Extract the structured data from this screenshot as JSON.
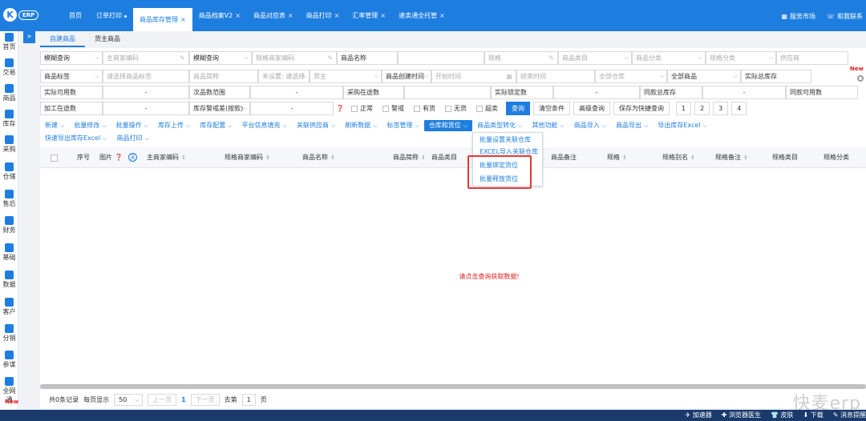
{
  "app": {
    "logo_letter": "K",
    "logo_text": "ERP"
  },
  "top_tabs": [
    {
      "label": "首页",
      "closable": false
    },
    {
      "label": "订单打印",
      "closable": false,
      "dot": true
    },
    {
      "label": "商品库存管理",
      "closable": true,
      "active": true
    },
    {
      "label": "商品档案V2",
      "closable": true
    },
    {
      "label": "商品对应表",
      "closable": true
    },
    {
      "label": "商品打印",
      "closable": true
    },
    {
      "label": "汇率管理",
      "closable": true
    },
    {
      "label": "速卖通全托管",
      "closable": true
    }
  ],
  "top_right": {
    "market": "服务市场",
    "contact": "和我联系"
  },
  "sidebar": [
    "首页",
    "交易",
    "商品",
    "库存",
    "采购",
    "仓储",
    "售后",
    "财务",
    "基础",
    "数据",
    "客户",
    "分销",
    "参谋",
    "全网通"
  ],
  "sidebar_new": "New",
  "sub_tabs": [
    "自建商品",
    "货主商品"
  ],
  "filters": {
    "row1": [
      "模糊查询",
      "主商家编码",
      "模糊查询",
      "规格商家编码",
      "商品名称",
      "",
      "规格",
      "商品类目",
      "商品分类",
      "规格分类",
      "供应商"
    ],
    "row2": [
      "商品标签",
      "请选择商品标签",
      "商品简称",
      "未设置: 请选择",
      "货主",
      "商品创建时间",
      "开始时间",
      "结束时间",
      "全部仓库",
      "全部商品",
      "实际总库存"
    ],
    "row3": [
      "实际可用数",
      "-",
      "次品数范围",
      "-",
      "采购在途数",
      "",
      "实际锁定数",
      "-",
      "同款总库存",
      "-",
      "同款可用数"
    ],
    "row4": [
      "加工在途数",
      "-",
      "库存警戒差(按款)",
      "-"
    ],
    "checkboxes": [
      "正常",
      "警戒",
      "有货",
      "无货",
      "超卖"
    ],
    "buttons": [
      "查询",
      "清空条件",
      "高级查询",
      "保存为快捷查询"
    ],
    "quick": [
      "1",
      "2",
      "3",
      "4"
    ]
  },
  "toolbar_row1": [
    "新建",
    "批量修改",
    "批量操作",
    "库存上传",
    "库存配置",
    "平台信息填充",
    "关联供应商",
    "刷新数据",
    "标签管理",
    "仓库和货位",
    "商品类型转化",
    "其他功能",
    "商品导入",
    "商品导出",
    "导出库存Excel"
  ],
  "toolbar_row2": [
    "快速导出库存Excel",
    "商品打印"
  ],
  "dropdown": [
    "批量设置关联仓库",
    "EXCEL导入关联仓库",
    "批量绑定货位",
    "批量释放货位"
  ],
  "corner_new": "New",
  "table_headers": [
    "序号",
    "图片",
    "天",
    "主商家编码",
    "规格商家编码",
    "商品名称",
    "商品简称",
    "商品类目",
    "商品备注",
    "规格",
    "规格别名",
    "规格备注",
    "规格类目",
    "规格分类"
  ],
  "empty_text": "请点击查询获取数据!",
  "pager": {
    "total": "共0条记录",
    "per_page_label": "每页显示",
    "per_page": "50",
    "prev": "上一页",
    "current": "1",
    "next": "下一页",
    "goto": "去第",
    "goto_val": "1",
    "page": "页"
  },
  "bottom": [
    "加速器",
    "浏览器医生",
    "皮肤",
    "下载",
    "消息提醒"
  ],
  "watermark": "快麦erp",
  "colors": {
    "primary": "#1e7ee0",
    "highlight": "#e53935",
    "empty_text": "#e02020"
  }
}
